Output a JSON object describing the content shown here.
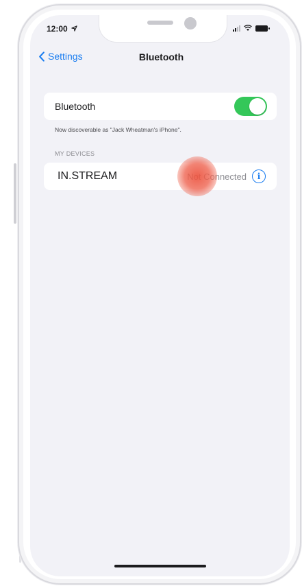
{
  "status_bar": {
    "time": "12:00",
    "location_icon": "location-arrow-icon"
  },
  "nav": {
    "back_label": "Settings",
    "title": "Bluetooth"
  },
  "bluetooth": {
    "label": "Bluetooth",
    "enabled": true,
    "discoverable_text": "Now discoverable as \"Jack Wheatman's iPhone\"."
  },
  "my_devices": {
    "header": "MY DEVICES",
    "devices": [
      {
        "name": "IN.STREAM",
        "status": "Not Connected"
      }
    ]
  },
  "colors": {
    "accent": "#1a7df0",
    "toggle_on": "#34c759",
    "background": "#f2f2f7",
    "tap_indicator": "#ec5440"
  }
}
